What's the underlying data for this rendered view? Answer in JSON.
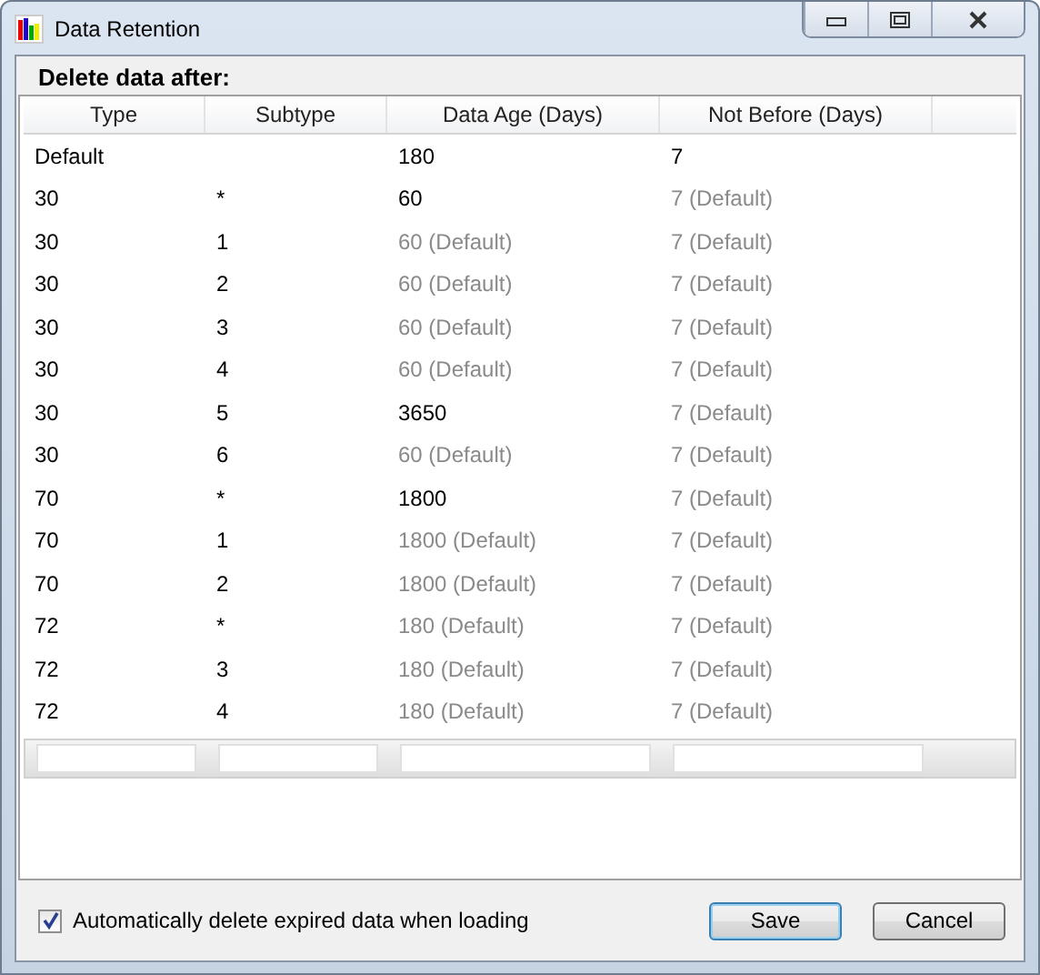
{
  "window": {
    "title": "Data Retention"
  },
  "group": {
    "title": "Delete data after:"
  },
  "table": {
    "columns": [
      "Type",
      "Subtype",
      "Data Age (Days)",
      "Not Before (Days)"
    ],
    "rows": [
      {
        "type": "Default",
        "subtype": "",
        "age": {
          "text": "180",
          "is_default": false
        },
        "not_before": {
          "text": "7",
          "is_default": false
        }
      },
      {
        "type": "30",
        "subtype": "*",
        "age": {
          "text": "60",
          "is_default": false
        },
        "not_before": {
          "text": "7 (Default)",
          "is_default": true
        }
      },
      {
        "type": "30",
        "subtype": "1",
        "age": {
          "text": "60 (Default)",
          "is_default": true
        },
        "not_before": {
          "text": "7 (Default)",
          "is_default": true
        }
      },
      {
        "type": "30",
        "subtype": "2",
        "age": {
          "text": "60 (Default)",
          "is_default": true
        },
        "not_before": {
          "text": "7 (Default)",
          "is_default": true
        }
      },
      {
        "type": "30",
        "subtype": "3",
        "age": {
          "text": "60 (Default)",
          "is_default": true
        },
        "not_before": {
          "text": "7 (Default)",
          "is_default": true
        }
      },
      {
        "type": "30",
        "subtype": "4",
        "age": {
          "text": "60 (Default)",
          "is_default": true
        },
        "not_before": {
          "text": "7 (Default)",
          "is_default": true
        }
      },
      {
        "type": "30",
        "subtype": "5",
        "age": {
          "text": "3650",
          "is_default": false
        },
        "not_before": {
          "text": "7 (Default)",
          "is_default": true
        }
      },
      {
        "type": "30",
        "subtype": "6",
        "age": {
          "text": "60 (Default)",
          "is_default": true
        },
        "not_before": {
          "text": "7 (Default)",
          "is_default": true
        }
      },
      {
        "type": "70",
        "subtype": "*",
        "age": {
          "text": "1800",
          "is_default": false
        },
        "not_before": {
          "text": "7 (Default)",
          "is_default": true
        }
      },
      {
        "type": "70",
        "subtype": "1",
        "age": {
          "text": "1800 (Default)",
          "is_default": true
        },
        "not_before": {
          "text": "7 (Default)",
          "is_default": true
        }
      },
      {
        "type": "70",
        "subtype": "2",
        "age": {
          "text": "1800 (Default)",
          "is_default": true
        },
        "not_before": {
          "text": "7 (Default)",
          "is_default": true
        }
      },
      {
        "type": "72",
        "subtype": "*",
        "age": {
          "text": "180 (Default)",
          "is_default": true
        },
        "not_before": {
          "text": "7 (Default)",
          "is_default": true
        }
      },
      {
        "type": "72",
        "subtype": "3",
        "age": {
          "text": "180 (Default)",
          "is_default": true
        },
        "not_before": {
          "text": "7 (Default)",
          "is_default": true
        }
      },
      {
        "type": "72",
        "subtype": "4",
        "age": {
          "text": "180 (Default)",
          "is_default": true
        },
        "not_before": {
          "text": "7 (Default)",
          "is_default": true
        }
      }
    ]
  },
  "auto_delete": {
    "label": "Automatically delete expired data when loading",
    "checked": true
  },
  "buttons": [
    {
      "label": "Save",
      "kind": "default"
    },
    {
      "label": "Cancel",
      "kind": "normal"
    }
  ]
}
